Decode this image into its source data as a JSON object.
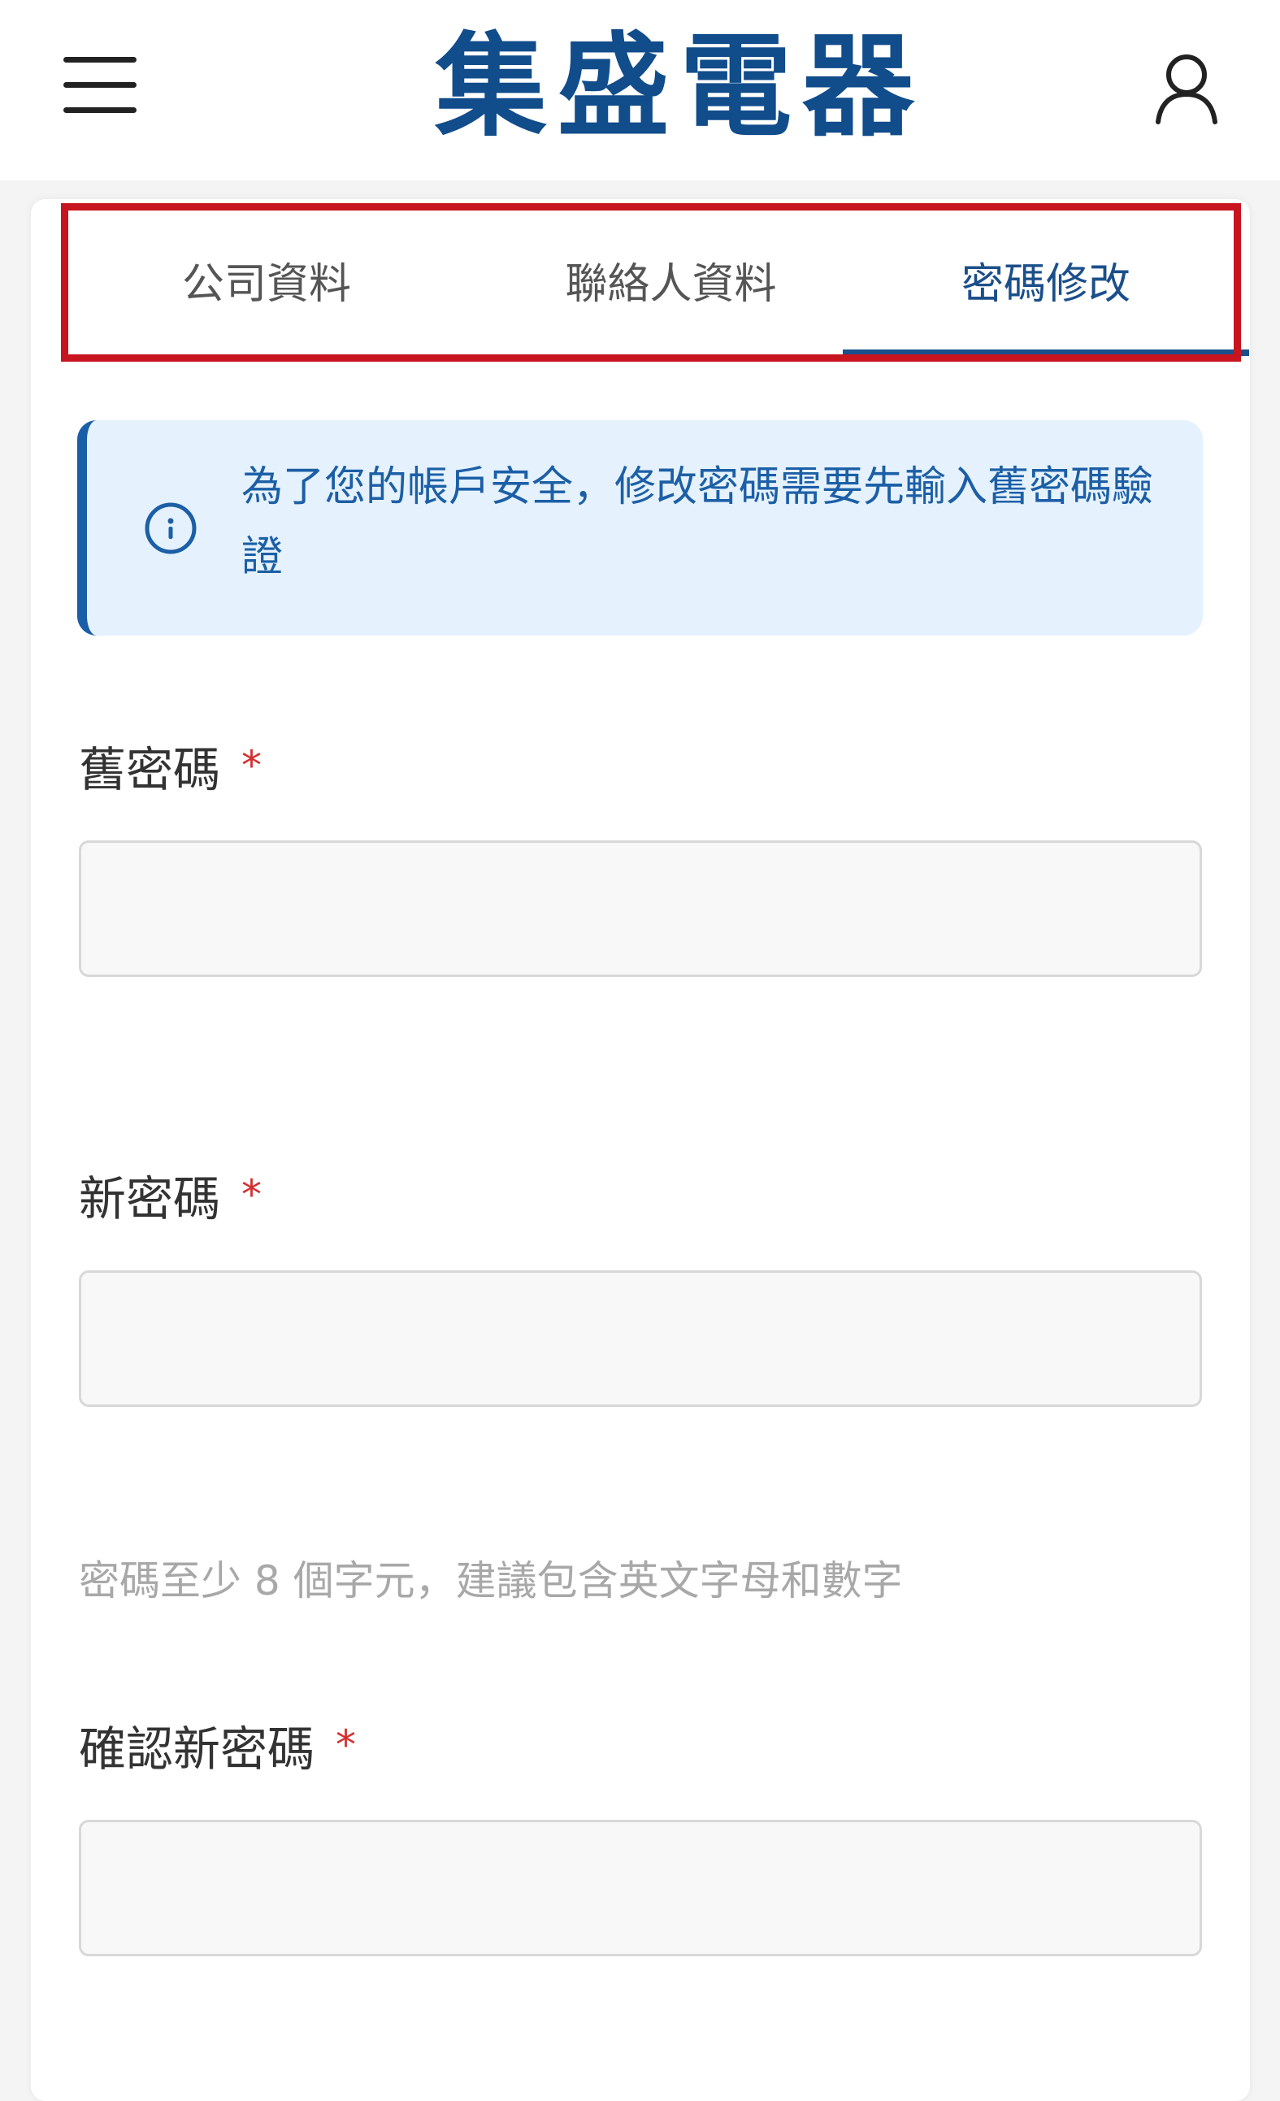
{
  "header": {
    "logo": [
      "集",
      "盛",
      "電",
      "器"
    ],
    "menu_icon": "menu-icon",
    "user_icon": "user-icon"
  },
  "tabs": [
    {
      "label": "公司資料",
      "active": false
    },
    {
      "label": "聯絡人資料",
      "active": false
    },
    {
      "label": "密碼修改",
      "active": true
    }
  ],
  "notice": {
    "icon": "info-icon",
    "text": "為了您的帳戶安全，修改密碼需要先輸入舊密碼驗證"
  },
  "form": {
    "old_password": {
      "label": "舊密碼",
      "required_mark": "*",
      "value": ""
    },
    "new_password": {
      "label": "新密碼",
      "required_mark": "*",
      "value": ""
    },
    "hint": "密碼至少 8 個字元，建議包含英文字母和數字",
    "confirm_password": {
      "label": "確認新密碼",
      "required_mark": "*",
      "value": ""
    }
  },
  "colors": {
    "brand": "#114c8b",
    "accent": "#1b4f8a",
    "notice_bg": "#e5f2fd",
    "notice_text": "#1c5fa6",
    "required": "#d32f2f",
    "highlight": "#c8141f"
  }
}
